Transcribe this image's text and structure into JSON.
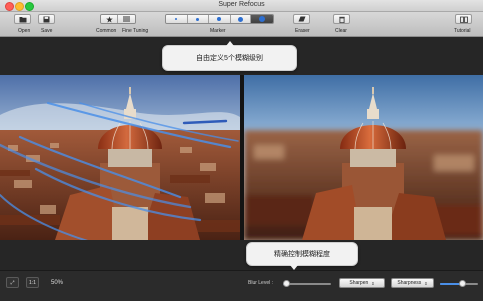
{
  "window": {
    "title": "Super Refocus"
  },
  "toolbar": {
    "open_label": "Open",
    "save_label": "Save",
    "common_label": "Common",
    "fine_tuning_label": "Fine Tuning",
    "marker_label": "Marker",
    "eraser_label": "Eraser",
    "clear_label": "Clear",
    "tutorial_label": "Tutorial"
  },
  "callouts": {
    "marker_tip": "自由定义5个模糊级别",
    "blur_tip": "精确控制模糊程度"
  },
  "bottom": {
    "fit_label": "⤢",
    "actual_size_label": "1:1",
    "zoom_text": "50%",
    "blur_level_label": "Blur Level :",
    "blur_level": 0.08,
    "effect_select": "Sharpen",
    "effect_param_select": "Sharpness",
    "sharpness_level": 0.6
  },
  "colors": {
    "stroke_blue": "#4a8fe8",
    "callout_bg": "#f2f2f2"
  }
}
